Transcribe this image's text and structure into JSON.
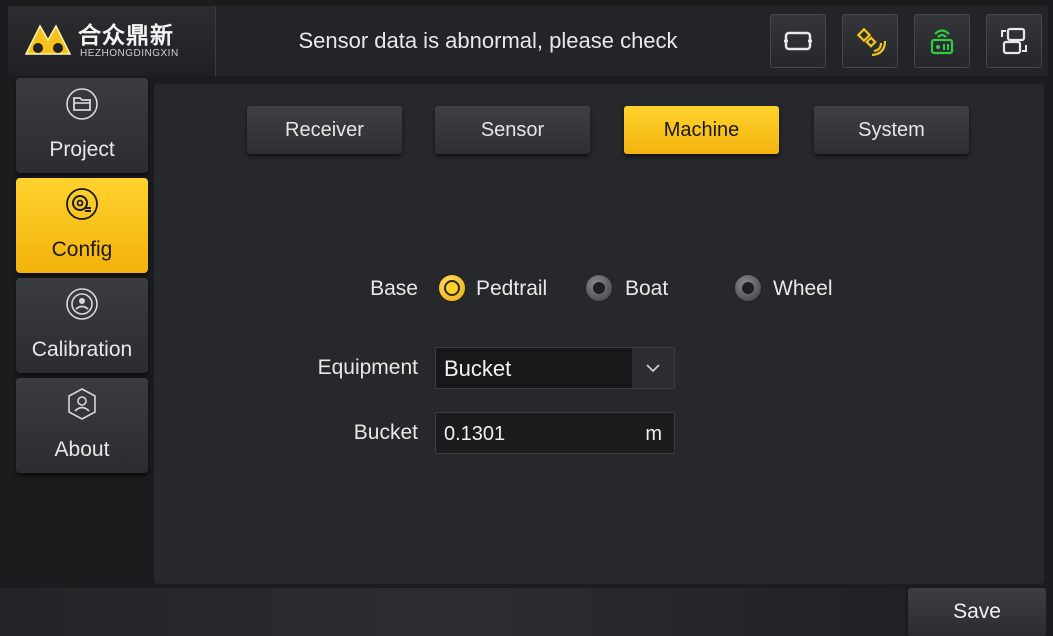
{
  "brand": {
    "name_cn": "合众鼎新",
    "name_en": "HEZHONGDINGXIN"
  },
  "status_message": "Sensor data is abnormal, please check",
  "top_icons": [
    {
      "name": "screen-icon"
    },
    {
      "name": "satellite-icon",
      "color": "#f3c61c"
    },
    {
      "name": "radio-signal-icon",
      "color": "#2ecc40"
    },
    {
      "name": "swap-icon"
    }
  ],
  "sidebar": {
    "items": [
      {
        "label": "Project",
        "icon": "folder-icon",
        "active": false
      },
      {
        "label": "Config",
        "icon": "gear-icon",
        "active": true
      },
      {
        "label": "Calibration",
        "icon": "calibration-icon",
        "active": false
      },
      {
        "label": "About",
        "icon": "about-icon",
        "active": false
      }
    ]
  },
  "tabs": [
    {
      "label": "Receiver",
      "active": false
    },
    {
      "label": "Sensor",
      "active": false
    },
    {
      "label": "Machine",
      "active": true
    },
    {
      "label": "System",
      "active": false
    }
  ],
  "form": {
    "base": {
      "label": "Base",
      "options": [
        {
          "label": "Pedtrail",
          "checked": true
        },
        {
          "label": "Boat",
          "checked": false
        },
        {
          "label": "Wheel",
          "checked": false
        }
      ]
    },
    "equipment": {
      "label": "Equipment",
      "value": "Bucket"
    },
    "bucket": {
      "label": "Bucket",
      "value": "0.1301",
      "unit": "m"
    }
  },
  "save_label": "Save",
  "colors": {
    "accent": "#f8c11a",
    "panel": "#26282b",
    "background": "#1b1c1e"
  }
}
